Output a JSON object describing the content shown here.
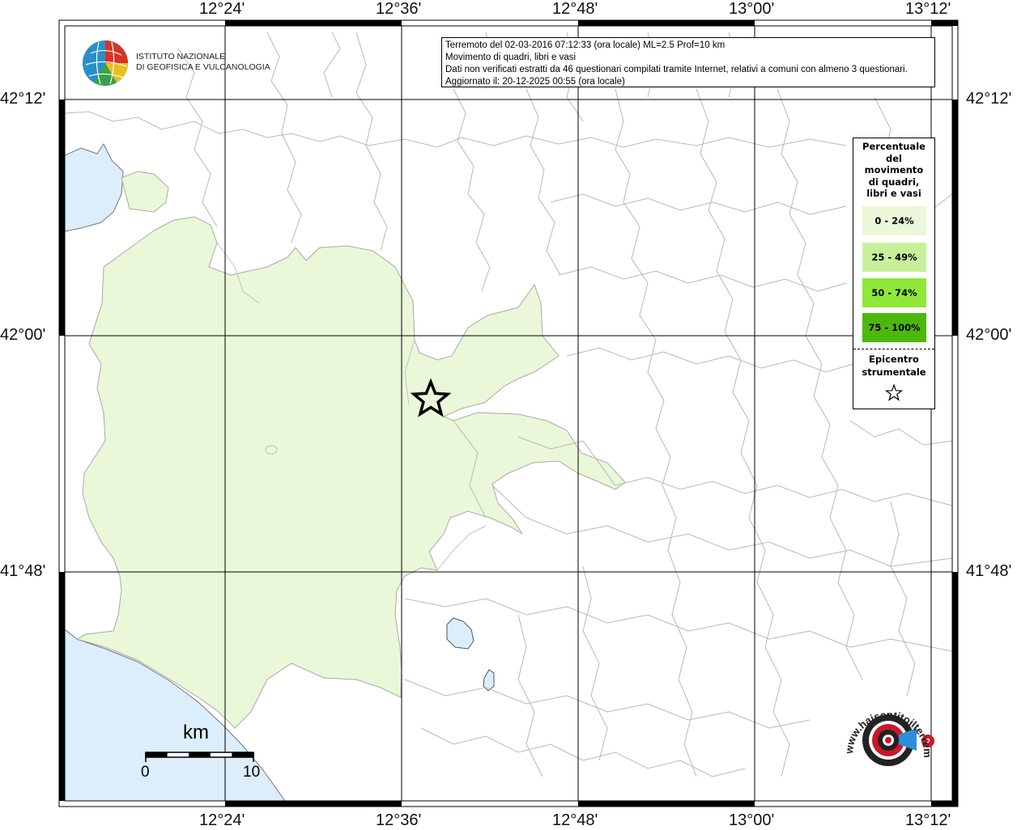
{
  "map": {
    "lon_labels": [
      "12°24'",
      "12°36'",
      "12°48'",
      "13°00'",
      "13°12'"
    ],
    "lat_labels": [
      "42°12'",
      "42°00'",
      "41°48'"
    ],
    "epicenter_symbol": "star-icon",
    "colors": {
      "sea": "#dcedfb",
      "affected_area": "#eaf7d8",
      "borders": "#b8b8b8",
      "grid": "#000000"
    }
  },
  "info": {
    "line1": "Terremoto del 02-03-2016 07:12:33 (ora locale) ML=2.5 Prof=10 km",
    "line2": "Movimento di quadri, libri e vasi",
    "line3": "Dati non verificati estratti da 46 questionari compilati tramite Internet, relativi a comuni con almeno 3 questionari.",
    "line4": "Aggiornato il: 20-12-2025 00:55 (ora locale)"
  },
  "ingv": {
    "line1": "ISTITUTO NAZIONALE",
    "line2": "DI GEOFISICA E VULCANOLOGIA"
  },
  "legend": {
    "title_lines": [
      "Percentuale",
      "del",
      "movimento",
      "di quadri,",
      "libri e vasi"
    ],
    "classes": [
      {
        "label": "0 - 24%",
        "color": "#eaf7d8"
      },
      {
        "label": "25 - 49%",
        "color": "#c8f09a"
      },
      {
        "label": "50 - 74%",
        "color": "#8fe83a"
      },
      {
        "label": "75 - 100%",
        "color": "#4cb80c"
      }
    ],
    "epicenter_lines": [
      "Epicentro",
      "strumentale"
    ]
  },
  "scale": {
    "unit": "km",
    "start": "0",
    "end": "10"
  },
  "hsit": {
    "text": "www.haisentitoilterremoto.it"
  }
}
